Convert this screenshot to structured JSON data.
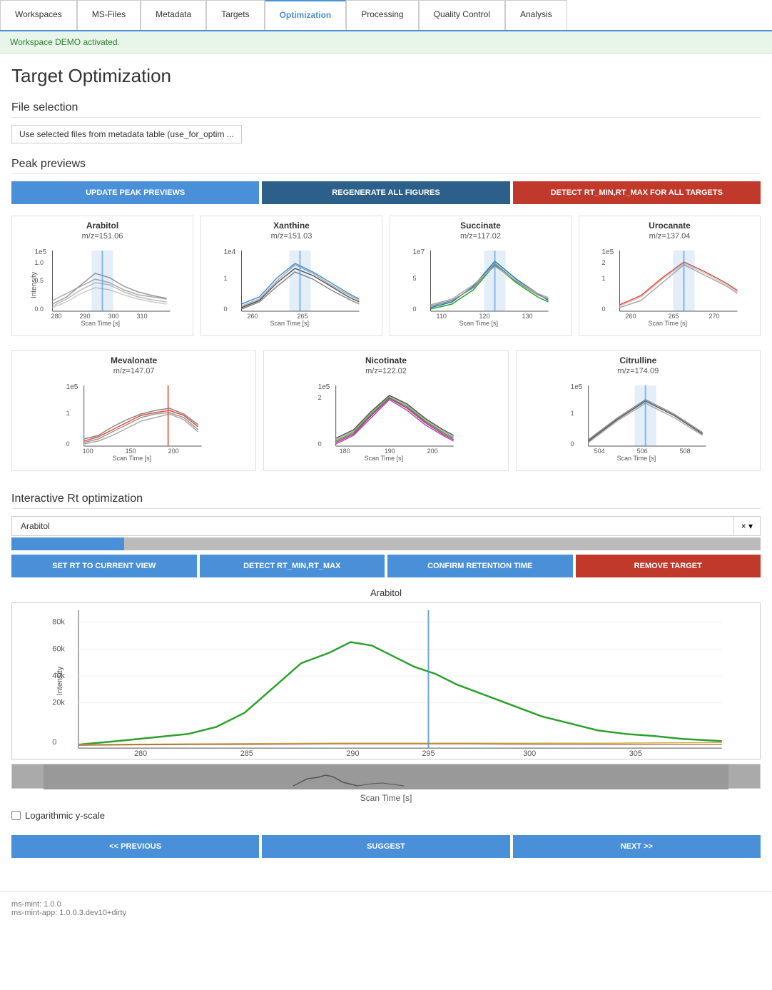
{
  "nav": {
    "items": [
      {
        "label": "Workspaces",
        "active": false
      },
      {
        "label": "MS-Files",
        "active": false
      },
      {
        "label": "Metadata",
        "active": false
      },
      {
        "label": "Targets",
        "active": false
      },
      {
        "label": "Optimization",
        "active": true
      },
      {
        "label": "Processing",
        "active": false
      },
      {
        "label": "Quality Control",
        "active": false
      },
      {
        "label": "Analysis",
        "active": false
      }
    ]
  },
  "workspace_banner": "Workspace DEMO activated.",
  "page_title": "Target Optimization",
  "file_selection": {
    "section_title": "File selection",
    "button_label": "Use selected files from metadata table (use_for_optim ..."
  },
  "peak_previews": {
    "section_title": "Peak previews",
    "buttons": {
      "update": "UPDATE PEAK PREVIEWS",
      "regenerate": "REGENERATE ALL FIGURES",
      "detect": "DETECT RT_MIN,RT_MAX FOR ALL TARGETS"
    }
  },
  "charts_row1": [
    {
      "title": "Arabitol",
      "subtitle": "m/z=151.06",
      "scale": "1e5",
      "x_min": 280,
      "x_max": 310,
      "x_ticks": [
        280,
        290,
        300,
        310
      ]
    },
    {
      "title": "Xanthine",
      "subtitle": "m/z=151.03",
      "scale": "1e4",
      "x_min": 255,
      "x_max": 270,
      "x_ticks": [
        260,
        265
      ]
    },
    {
      "title": "Succinate",
      "subtitle": "m/z=117.02",
      "scale": "1e7",
      "x_min": 105,
      "x_max": 135,
      "x_ticks": [
        110,
        120,
        130
      ]
    },
    {
      "title": "Urocanate",
      "subtitle": "m/z=137.04",
      "scale": "1e5",
      "x_min": 258,
      "x_max": 275,
      "x_ticks": [
        260,
        265,
        270
      ]
    }
  ],
  "charts_row2": [
    {
      "title": "Mevalonate",
      "subtitle": "m/z=147.07",
      "scale": "1e5",
      "x_min": 90,
      "x_max": 215,
      "x_ticks": [
        100,
        150,
        200
      ]
    },
    {
      "title": "Nicotinate",
      "subtitle": "m/z=122.02",
      "scale": "1e5",
      "x_min": 175,
      "x_max": 205,
      "x_ticks": [
        180,
        190,
        200
      ]
    },
    {
      "title": "Citrulline",
      "subtitle": "m/z=174.09",
      "scale": "1e5",
      "x_min": 502,
      "x_max": 510,
      "x_ticks": [
        504,
        506,
        508
      ]
    }
  ],
  "rt_optimization": {
    "section_title": "Interactive Rt optimization",
    "target_name": "Arabitol",
    "close_label": "× ▾",
    "buttons": {
      "set_rt": "SET RT TO CURRENT VIEW",
      "detect": "DETECT RT_MIN,RT_MAX",
      "confirm": "CONFIRM RETENTION TIME",
      "remove": "REMOVE TARGET"
    },
    "chart_title": "Arabitol",
    "y_label": "Intensity",
    "x_label": "Scan Time [s]",
    "y_ticks": [
      "80k",
      "60k",
      "40k",
      "20k",
      "0"
    ],
    "x_ticks": [
      "280",
      "285",
      "290",
      "295",
      "300",
      "305"
    ],
    "log_scale_label": "Logarithmic y-scale"
  },
  "nav_buttons": {
    "previous": "<< PREVIOUS",
    "suggest": "SUGGEST",
    "next": "NEXT >>"
  },
  "footer": {
    "line1": "ms-mint: 1.0.0",
    "line2": "ms-mint-app: 1.0.0.3.dev10+dirty"
  }
}
